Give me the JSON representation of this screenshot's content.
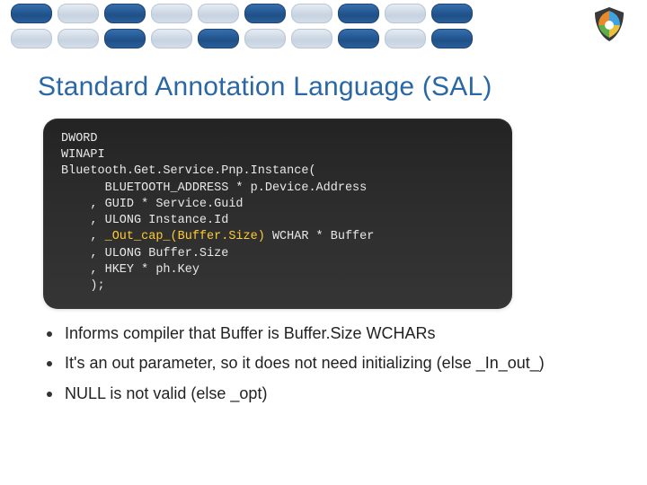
{
  "title": "Standard Annotation Language (SAL)",
  "code": {
    "l1": "DWORD",
    "l2": "WINAPI",
    "l3": "Bluetooth.Get.Service.Pnp.Instance(",
    "l4": "      BLUETOOTH_ADDRESS * p.Device.Address",
    "l5": "    , GUID * Service.Guid",
    "l6": "    , ULONG Instance.Id",
    "l7a": "    , ",
    "l7hl": "_Out_cap_(Buffer.Size)",
    "l7b": " WCHAR * Buffer",
    "l8": "    , ULONG Buffer.Size",
    "l9": "    , HKEY * ph.Key",
    "l10": "    );"
  },
  "bullets": {
    "b1": "Informs compiler that Buffer is Buffer.Size WCHARs",
    "b2": "It's an out parameter, so it does not need initializing (else _In_out_)",
    "b3": "NULL is not valid (else _opt)"
  }
}
